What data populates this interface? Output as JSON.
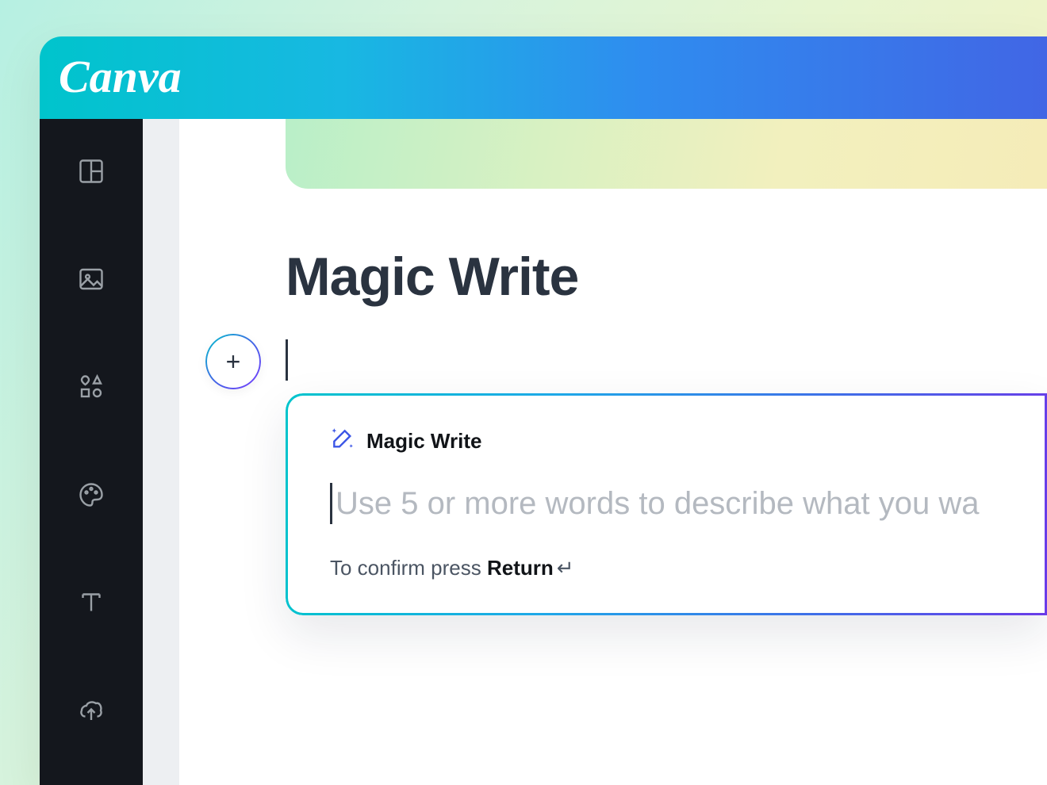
{
  "brand": {
    "name": "Canva"
  },
  "sidebar": {
    "icons": [
      "layout",
      "image",
      "elements",
      "colors",
      "text",
      "upload"
    ]
  },
  "page": {
    "title": "Magic Write"
  },
  "plus_button": {
    "glyph": "+"
  },
  "magic_panel": {
    "header_label": "Magic Write",
    "placeholder": "Use 5 or more words to describe what you wa",
    "hint_prefix": "To confirm press ",
    "hint_key": "Return",
    "hint_glyph": "↵"
  }
}
